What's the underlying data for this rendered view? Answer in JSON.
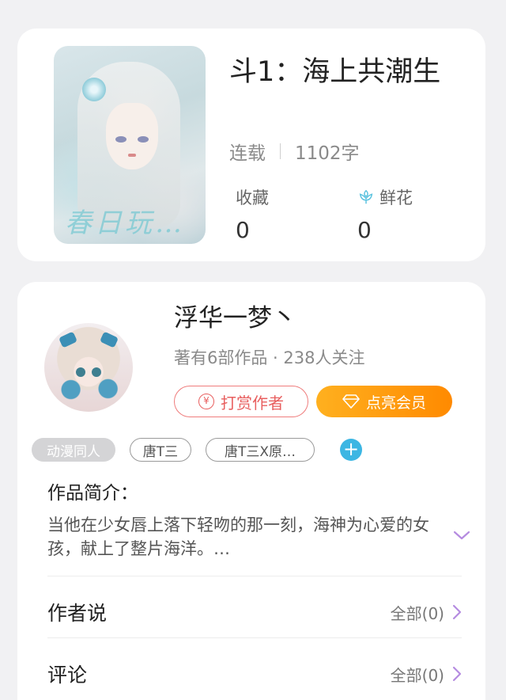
{
  "book": {
    "title": "斗1：海上共潮生",
    "status": "连载",
    "word_count": "1102字",
    "favorites_label": "收藏",
    "favorites_value": "0",
    "flowers_label": "鲜花",
    "flowers_value": "0",
    "cover_text": "春日玩…"
  },
  "author": {
    "name": "浮华一梦丶",
    "meta": "著有6部作品 · 238人关注",
    "tip_label": "打赏作者",
    "tip_icon_text": "¥",
    "vip_label": "点亮会员"
  },
  "tags": [
    "动漫同人",
    "唐T三",
    "唐T三X原…"
  ],
  "intro": {
    "title": "作品简介：",
    "text": "当他在少女唇上落下轻吻的那一刻，海神为心爱的女孩，献上了整片海洋。…"
  },
  "rows": [
    {
      "label": "作者说",
      "right": "全部(0)"
    },
    {
      "label": "评论",
      "right": "全部(0)"
    }
  ],
  "colors": {
    "accent_purple": "#b58be0",
    "tip_red": "#e85f5f",
    "vip_orange": "#ff8a00",
    "add_blue": "#3cb6e3",
    "flower_blue": "#5cc3df"
  }
}
